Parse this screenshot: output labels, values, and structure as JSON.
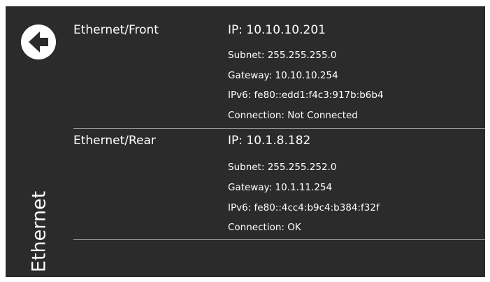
{
  "sidebar": {
    "title": "Ethernet",
    "back_icon": "back-arrow-icon"
  },
  "interfaces": [
    {
      "name": "Ethernet/Front",
      "ip": "IP: 10.10.10.201",
      "subnet": "Subnet: 255.255.255.0",
      "gateway": "Gateway: 10.10.10.254",
      "ipv6": "IPv6: fe80::edd1:f4c3:917b:b6b4",
      "connection": "Connection: Not Connected"
    },
    {
      "name": "Ethernet/Rear",
      "ip": "IP: 10.1.8.182",
      "subnet": "Subnet: 255.255.252.0",
      "gateway": "Gateway: 10.1.11.254",
      "ipv6": "IPv6: fe80::4cc4:b9c4:b384:f32f",
      "connection": "Connection: OK"
    }
  ],
  "colors": {
    "background": "#2b2b2b",
    "text": "#ffffff",
    "divider": "#9a9a9a"
  }
}
